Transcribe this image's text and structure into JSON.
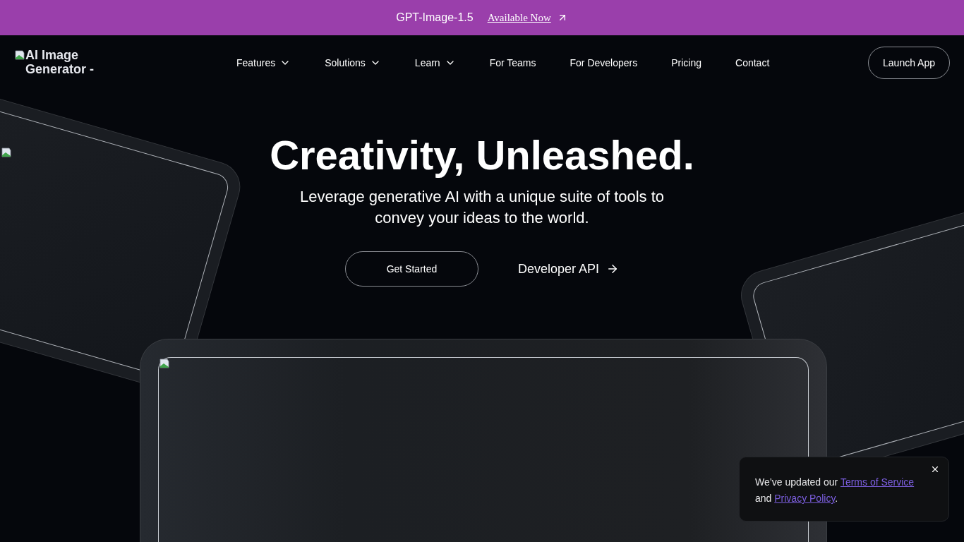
{
  "announcement": {
    "text": "GPT-Image-1.5",
    "link": "Available Now"
  },
  "nav": {
    "logo_alt": "AI Image Generator -",
    "items": [
      {
        "label": "Features",
        "has_menu": true
      },
      {
        "label": "Solutions",
        "has_menu": true
      },
      {
        "label": "Learn",
        "has_menu": true
      },
      {
        "label": "For Teams",
        "has_menu": false
      },
      {
        "label": "For Developers",
        "has_menu": false
      },
      {
        "label": "Pricing",
        "has_menu": false
      },
      {
        "label": "Contact",
        "has_menu": false
      }
    ],
    "cta": "Launch App"
  },
  "hero": {
    "title": "Creativity, Unleashed.",
    "subtitle": "Leverage generative AI with a unique suite of tools to convey your ideas to the world.",
    "primary_button": "Get Started",
    "secondary_link": "Developer API"
  },
  "notice": {
    "text_before": "We’ve updated our",
    "terms_link": "Terms of Service",
    "text_middle": "and",
    "privacy_link": "Privacy Policy",
    "text_after": "."
  }
}
